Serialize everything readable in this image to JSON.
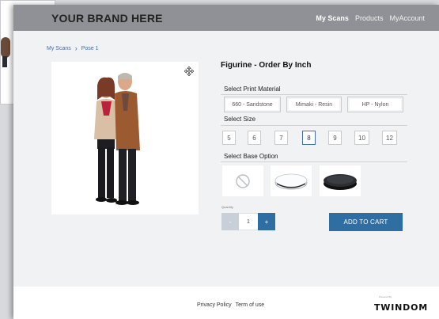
{
  "header": {
    "brand": "YOUR BRAND HERE",
    "nav": [
      "My Scans",
      "Products",
      "MyAccount"
    ]
  },
  "breadcrumb": [
    "My Scans",
    "Pose 1"
  ],
  "product": {
    "title": "Figurine - Order By Inch",
    "material_label": "Select Print Material",
    "materials": [
      "660 - Sandstone",
      "Mimaki - Resin",
      "HP - Nylon"
    ],
    "size_label": "Select Size",
    "sizes": [
      "5",
      "6",
      "7",
      "8",
      "9",
      "10",
      "12"
    ],
    "selected_size": "8",
    "base_label": "Select Base Option",
    "bases": [
      "no-base-icon",
      "clear-base-icon",
      "black-base-icon"
    ]
  },
  "quantity": {
    "label": "Quantity",
    "minus": "-",
    "value": "1",
    "plus": "+"
  },
  "cart": {
    "label": "ADD TO CART"
  },
  "footer": {
    "privacy": "Privacy Policy",
    "terms": "Term of use",
    "powered_by": "Powered By",
    "logo": "TWINDOM"
  },
  "colors": {
    "topbar": "#8f9196",
    "accent": "#2e6ea3",
    "link": "#3a6fb0"
  }
}
